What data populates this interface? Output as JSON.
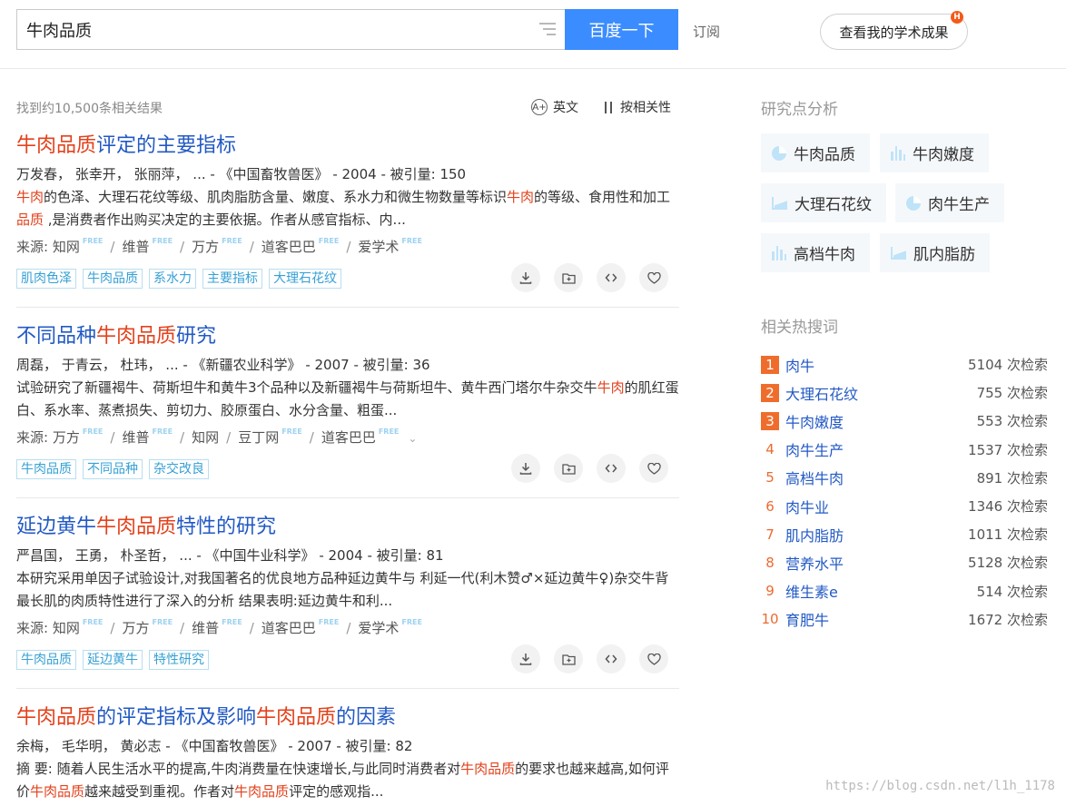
{
  "search": {
    "query": "牛肉品质",
    "button_label": "百度一下",
    "subscribe_label": "订阅",
    "my_results_label": "查看我的学术成果",
    "badge": "H"
  },
  "toolbar": {
    "result_count": "找到约10,500条相关结果",
    "language_label": "英文",
    "language_icon": "A+",
    "sort_label": "按相关性"
  },
  "results": [
    {
      "title": [
        {
          "t": "牛肉品质",
          "h": true
        },
        {
          "t": "评定的主要指标",
          "h": false
        }
      ],
      "meta": "万发春，  张幸开，  张丽萍，  ... - 《中国畜牧兽医》 - 2004 - 被引量: 150",
      "abstract": [
        {
          "t": "牛肉",
          "h": true
        },
        {
          "t": "的色泽、大理石花纹等级、肌肉脂肪含量、嫩度、系水力和微生物数量等标识",
          "h": false
        },
        {
          "t": "牛肉",
          "h": true
        },
        {
          "t": "的等级、食用性和加工",
          "h": false
        },
        {
          "t": "品质",
          "h": true
        },
        {
          "t": " ,是消费者作出购买决定的主要依据。作者从感官指标、内...",
          "h": false
        }
      ],
      "source_label": "来源:",
      "sources": [
        {
          "name": "知网",
          "free": "FREE"
        },
        {
          "name": "维普",
          "free": "FREE"
        },
        {
          "name": "万方",
          "free": "FREE"
        },
        {
          "name": "道客巴巴",
          "free": "FREE"
        },
        {
          "name": "爱学术",
          "free": "FREE"
        }
      ],
      "tags": [
        "肌肉色泽",
        "牛肉品质",
        "系水力",
        "主要指标",
        "大理石花纹"
      ]
    },
    {
      "title": [
        {
          "t": "不同品种",
          "h": false
        },
        {
          "t": "牛肉品质",
          "h": true
        },
        {
          "t": "研究",
          "h": false
        }
      ],
      "meta": "周磊，  于青云，  杜玮，  ... - 《新疆农业科学》 - 2007 - 被引量: 36",
      "abstract": [
        {
          "t": "试验研究了新疆褐牛、荷斯坦牛和黄牛3个品种以及新疆褐牛与荷斯坦牛、黄牛西门塔尔牛杂交牛",
          "h": false
        },
        {
          "t": "牛肉",
          "h": true
        },
        {
          "t": "的肌红蛋白、系水率、蒸煮损失、剪切力、胶原蛋白、水分含量、粗蛋...",
          "h": false
        }
      ],
      "source_label": "来源:",
      "sources": [
        {
          "name": "万方",
          "free": "FREE"
        },
        {
          "name": "维普",
          "free": "FREE"
        },
        {
          "name": "知网",
          "free": ""
        },
        {
          "name": "豆丁网",
          "free": "FREE"
        },
        {
          "name": "道客巴巴",
          "free": "FREE"
        }
      ],
      "more_icon": "chevron-down-icon",
      "tags": [
        "牛肉品质",
        "不同品种",
        "杂交改良"
      ]
    },
    {
      "title": [
        {
          "t": "延边黄牛",
          "h": false
        },
        {
          "t": "牛肉品质",
          "h": true
        },
        {
          "t": "特性的研究",
          "h": false
        }
      ],
      "meta": "严昌国，  王勇，  朴圣哲，  ... - 《中国牛业科学》 - 2004 - 被引量: 81",
      "abstract": [
        {
          "t": "本研究采用单因子试验设计,对我国著名的优良地方品种延边黄牛与 利延一代(利木赞♂×延边黄牛♀)杂交牛背最长肌的肉质特性进行了深入的分析 结果表明:延边黄牛和利...",
          "h": false
        }
      ],
      "source_label": "来源:",
      "sources": [
        {
          "name": "知网",
          "free": "FREE"
        },
        {
          "name": "万方",
          "free": "FREE"
        },
        {
          "name": "维普",
          "free": "FREE"
        },
        {
          "name": "道客巴巴",
          "free": "FREE"
        },
        {
          "name": "爱学术",
          "free": "FREE"
        }
      ],
      "tags": [
        "牛肉品质",
        "延边黄牛",
        "特性研究"
      ]
    },
    {
      "title": [
        {
          "t": "牛肉品质",
          "h": true
        },
        {
          "t": "的评定指标及影响",
          "h": false
        },
        {
          "t": "牛肉品质",
          "h": true
        },
        {
          "t": "的因素",
          "h": false
        }
      ],
      "meta": "余梅，  毛华明，  黄必志  - 《中国畜牧兽医》 - 2007 - 被引量: 82",
      "abstract": [
        {
          "t": "摘    要: 随着人民生活水平的提高,牛肉消费量在快速增长,与此同时消费者对",
          "h": false
        },
        {
          "t": "牛肉品质",
          "h": true
        },
        {
          "t": "的要求也越来越高,如何评价",
          "h": false
        },
        {
          "t": "牛肉品质",
          "h": true
        },
        {
          "t": "越来越受到重视。作者对",
          "h": false
        },
        {
          "t": "牛肉品质",
          "h": true
        },
        {
          "t": "评定的感观指...",
          "h": false
        }
      ],
      "tags": []
    }
  ],
  "actions": {
    "download_icon": "download-icon",
    "folder_icon": "folder-add-icon",
    "cite_icon": "code-icon",
    "favorite_icon": "heart-icon"
  },
  "sidebar": {
    "analysis_title": "研究点分析",
    "topics": [
      {
        "label": "牛肉品质",
        "icon": "pie-chart-icon"
      },
      {
        "label": "牛肉嫩度",
        "icon": "bar-chart-icon"
      },
      {
        "label": "大理石花纹",
        "icon": "area-chart-icon"
      },
      {
        "label": "肉牛生产",
        "icon": "pie-chart-icon"
      },
      {
        "label": "高档牛肉",
        "icon": "bar-chart-icon"
      },
      {
        "label": "肌内脂肪",
        "icon": "area-chart-icon"
      }
    ],
    "hot_title": "相关热搜词",
    "hot": [
      {
        "rank": "1",
        "term": "肉牛",
        "count": "5104 次检索"
      },
      {
        "rank": "2",
        "term": "大理石花纹",
        "count": "755 次检索"
      },
      {
        "rank": "3",
        "term": "牛肉嫩度",
        "count": "553 次检索"
      },
      {
        "rank": "4",
        "term": "肉牛生产",
        "count": "1537 次检索"
      },
      {
        "rank": "5",
        "term": "高档牛肉",
        "count": "891 次检索"
      },
      {
        "rank": "6",
        "term": "肉牛业",
        "count": "1346 次检索"
      },
      {
        "rank": "7",
        "term": "肌内脂肪",
        "count": "1011 次检索"
      },
      {
        "rank": "8",
        "term": "营养水平",
        "count": "5128 次检索"
      },
      {
        "rank": "9",
        "term": "维生素e",
        "count": "514 次检索"
      },
      {
        "rank": "10",
        "term": "育肥牛",
        "count": "1672 次检索"
      }
    ]
  },
  "watermark": "https://blog.csdn.net/l1h_1178",
  "colors": {
    "accent": "#3b8cff",
    "link": "#2259c4",
    "highlight": "#e3421c",
    "tag": "#35a0d4",
    "rank": "#ef6d2c"
  }
}
